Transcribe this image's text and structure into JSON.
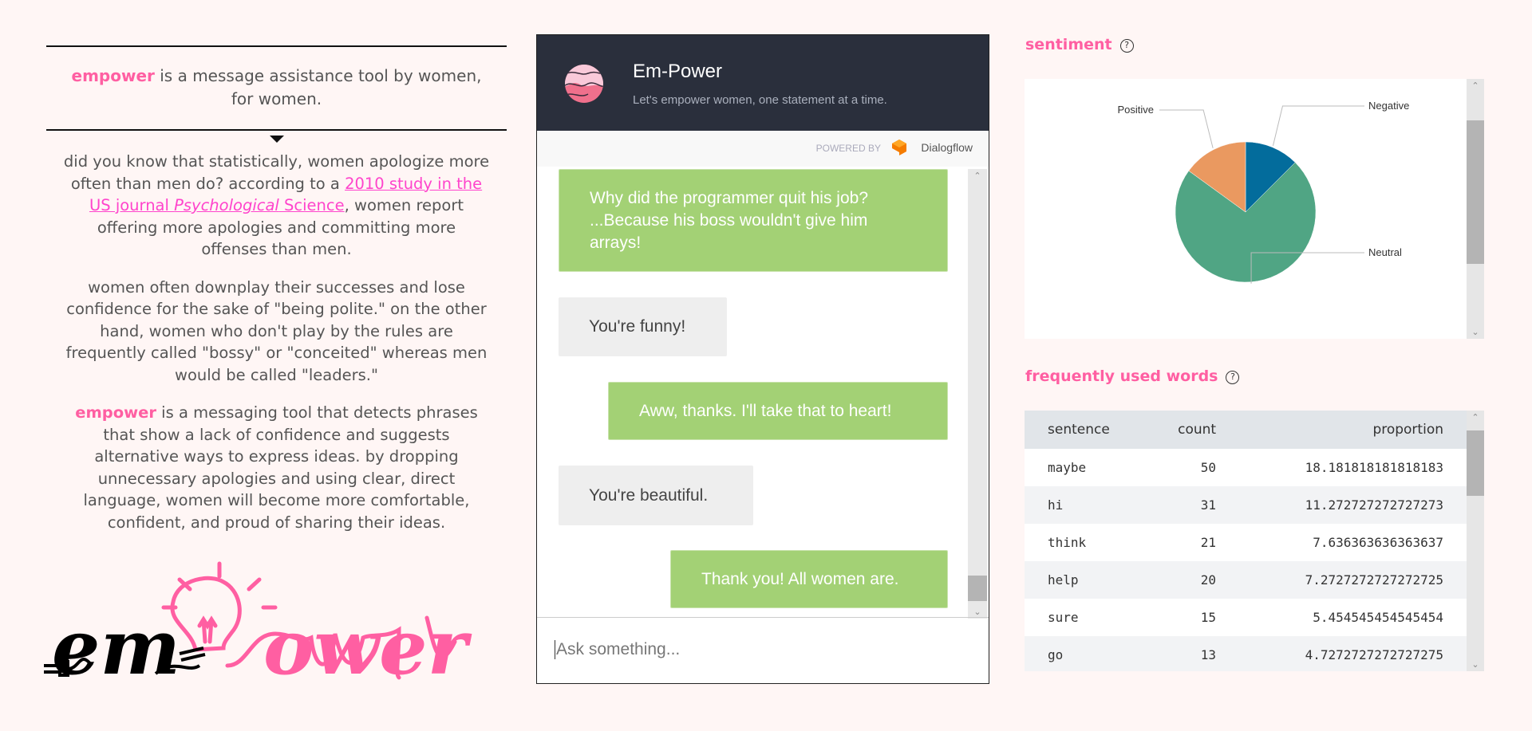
{
  "intro": {
    "brand": "empower",
    "text": " is a message assistance tool by women, for women."
  },
  "paragraphs": {
    "p1_before": "did you know that statistically, women apologize more often than men do? according to a ",
    "p1_link_a": "2010 study in the US journal ",
    "p1_link_italic": "Psychological",
    "p1_link_b": " Science",
    "p1_after": ", women report offering more apologies and committing more offenses than men.",
    "p2": "women often downplay their successes and lose confidence for the sake of \"being polite.\" on the other hand, women who don't play by the rules are frequently called \"bossy\" or \"conceited\" whereas men would be called \"leaders.\"",
    "p3_brand": "empower",
    "p3": " is a messaging tool that detects phrases that show a lack of confidence and suggests alternative ways to express ideas. by dropping unnecessary apologies and using clear, direct language, women will become more comfortable, confident, and proud of sharing their ideas."
  },
  "logo": {
    "text": "empower"
  },
  "chat": {
    "title": "Em-Power",
    "subtitle": "Let's empower women, one statement at a time.",
    "powered_by": "POWERED BY",
    "provider": "Dialogflow",
    "messages": [
      {
        "from": "user",
        "text": "Why did the programmer quit his job? ...Because his boss wouldn't give him arrays!"
      },
      {
        "from": "bot",
        "text": "You're funny!"
      },
      {
        "from": "user",
        "text": "Aww, thanks. I'll take that to heart!"
      },
      {
        "from": "bot",
        "text": "You're beautiful."
      },
      {
        "from": "user",
        "text": "Thank you! All women are."
      }
    ],
    "input_placeholder": "Ask something..."
  },
  "sentiment": {
    "title": "sentiment",
    "help": "?"
  },
  "chart_data": {
    "type": "pie",
    "title": "sentiment",
    "categories": [
      "Negative",
      "Neutral",
      "Positive"
    ],
    "values": [
      12.5,
      72.5,
      15
    ],
    "colors": [
      "#036c9c",
      "#50a584",
      "#ea9960"
    ]
  },
  "words": {
    "title": "frequently used words",
    "help": "?",
    "columns": [
      "sentence",
      "count",
      "proportion"
    ],
    "rows": [
      [
        "maybe",
        "50",
        "18.181818181818183"
      ],
      [
        "hi",
        "31",
        "11.272727272727273"
      ],
      [
        "think",
        "21",
        "7.636363636363637"
      ],
      [
        "help",
        "20",
        "7.2727272727272725"
      ],
      [
        "sure",
        "15",
        "5.454545454545454"
      ],
      [
        "go",
        "13",
        "4.7272727272727275"
      ]
    ]
  },
  "colors": {
    "brand_pink": "#ff5fa2",
    "header_dark": "#2a2f3c",
    "user_bubble": "#a3d175",
    "bot_bubble": "#eeeeee"
  }
}
